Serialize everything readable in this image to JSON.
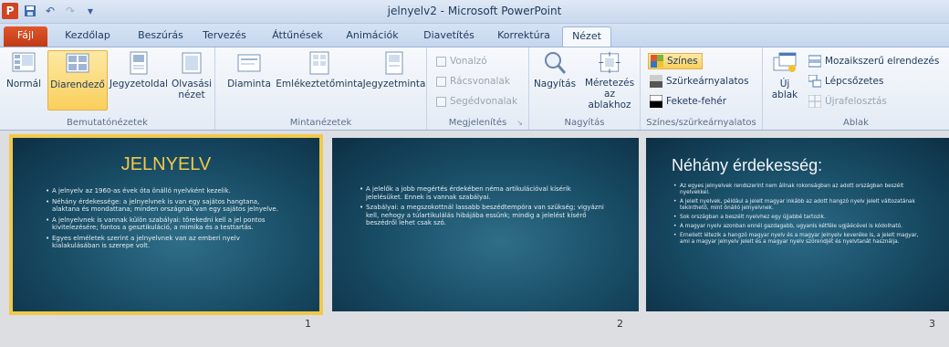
{
  "window": {
    "title": "jelnyelv2 - Microsoft PowerPoint",
    "app_icon": "P"
  },
  "tabs": [
    "Fájl",
    "Kezdőlap",
    "Beszúrás",
    "Tervezés",
    "Áttűnések",
    "Animációk",
    "Diavetítés",
    "Korrektúra",
    "Nézet"
  ],
  "ribbon": {
    "bemutato": {
      "label": "Bemutatónézetek",
      "buttons": [
        "Normál",
        "Diarendező",
        "Jegyzetoldal",
        "Olvasási nézet"
      ]
    },
    "minta": {
      "label": "Mintanézetek",
      "buttons": [
        "Diaminta",
        "Emlékeztetőminta",
        "Jegyzetminta"
      ]
    },
    "megjelenites": {
      "label": "Megjelenítés",
      "items": [
        "Vonalzó",
        "Rácsvonalak",
        "Segédvonalak"
      ]
    },
    "nagyitas": {
      "label": "Nagyítás",
      "buttons": [
        "Nagyítás",
        "Méretezés az ablakhoz"
      ]
    },
    "szines": {
      "label": "Színes/szürkeárnyalatos",
      "items": [
        "Színes",
        "Szürkeárnyalatos",
        "Fekete-fehér"
      ]
    },
    "ablak": {
      "label": "Ablak",
      "new_window": "Új ablak",
      "items": [
        "Mozaikszerű elrendezés",
        "Lépcsőzetes",
        "Újrafelosztás"
      ]
    }
  },
  "slides": [
    {
      "number": "1",
      "title": "JELNYELV",
      "bullets": [
        "A jelnyelv az 1960-as évek óta önálló nyelvként kezelik.",
        "Néhány érdekessége: a jelnyelvnek is van egy sajátos hangtana, alaktana és mondattana; minden országnak van egy sajátos jelnyelve.",
        "A jelnyelvnek is vannak külön szabályai: törekedni kell a jel pontos kivitelezésére; fontos a gesztikuláció, a mimika és a testtartás.",
        "Egyes elméletek szerint a jelnyelvnek van az emberi nyelv kialakulásában is szerepe volt."
      ]
    },
    {
      "number": "2",
      "title": "",
      "bullets": [
        "A jelelők a jobb megértés érdekében néma artikulációval kísérik jelelésüket. Ennek is vannak szabályai.",
        "Szabályai: a megszokottnál lassabb beszédtempóra van szükség; vigyázni kell, nehogy a túlartikulálás hibájába essünk; mindig a jelelést kísérő beszédről lehet csak szó."
      ]
    },
    {
      "number": "3",
      "title": "Néhány érdekesség:",
      "bullets": [
        "Az egyes jelnyelvek rendszerint nem állnak rokonságban az adott országban beszélt nyelvekkel.",
        "A jelelt nyelvek, például a jelelt magyar inkább az adott hangzó nyelv jelelt változatának tekinthető, mint önálló jelnyelvnek.",
        "Sok országban a beszélt nyelvhez egy újjabbé tartozik.",
        "A magyar nyelv azonban ennél gazdagabb, ugyanis kétféle ugjáécével is kódolható.",
        "Ernellett létezik a hangzó magyar nyelv és a magyar jelnyelv keveréke is, a jelelt magyar, ami a magyar jelnyelv jeleit és a magyar nyelv szórendjét és nyelvtanát használja."
      ]
    }
  ]
}
